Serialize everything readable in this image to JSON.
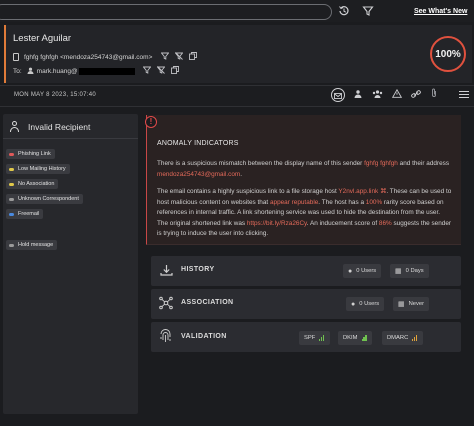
{
  "topbar": {
    "search_value": "",
    "history_icon": "history-icon",
    "filter_icon": "filter-icon",
    "whats_new": "See What's New"
  },
  "header": {
    "sender_name": "Lester Aguilar",
    "from_display": "fghfg fghfgh <mendoza254743@gmail.com>",
    "to_label": "To:",
    "to_value": "mark.huang@",
    "score": "100%",
    "accent_color": "#e07b39",
    "score_color": "#e0513e"
  },
  "datebar": {
    "date": "MON MAY 8 2023, 15:07:40",
    "tools": [
      "envelope-icon",
      "people-icon",
      "group-icon",
      "warning-icon",
      "link-icon",
      "attachment-icon",
      "hamburger-menu-icon"
    ]
  },
  "left_panel": {
    "title": "Invalid Recipient",
    "tags": [
      {
        "label": "Phishing Link",
        "color": "#e05a5a"
      },
      {
        "label": "Low Mailing History",
        "color": "#e0c84a"
      },
      {
        "label": "No Association",
        "color": "#e0c84a"
      },
      {
        "label": "Unknown Correspondent",
        "color": "#9a9a9a"
      },
      {
        "label": "Freemail",
        "color": "#4a8ae0"
      }
    ],
    "hold_message": "Hold message"
  },
  "anomaly": {
    "title": "ANOMALY INDICATORS",
    "p1_a": "There is a suspicious mismatch between the display name of this sender ",
    "p1_name": "fghfg fghfgh",
    "p1_b": " and their address ",
    "p1_addr": "mendoza254743@gmail.com",
    "p1_c": ".",
    "p2_a": "The email contains a highly suspicious link to a file storage host ",
    "p2_host": "Y2nvl.app.link",
    "p2_b": ". These can be used to host malicious content on websites that ",
    "p2_rep": "appear reputable",
    "p2_c": ". The host has a ",
    "p2_pct": "100%",
    "p2_d": " rarity score based on references in internal traffic. A link shortening service was used to hide the destination from the user. The original shortened link was ",
    "p2_link": "https://bit.ly/Rza26Cy",
    "p2_e": ". An inducement score of ",
    "p2_score": "86%",
    "p2_f": " suggests the sender is trying to induce the user into clicking."
  },
  "sections": {
    "history": {
      "label": "HISTORY",
      "users": "0 Users",
      "days": "0 Days"
    },
    "association": {
      "label": "ASSOCIATION",
      "users": "0 Users",
      "never": "Never"
    },
    "validation": {
      "label": "VALIDATION",
      "spf": "SPF",
      "dkim": "DKIM",
      "dmarc": "DMARC"
    }
  }
}
